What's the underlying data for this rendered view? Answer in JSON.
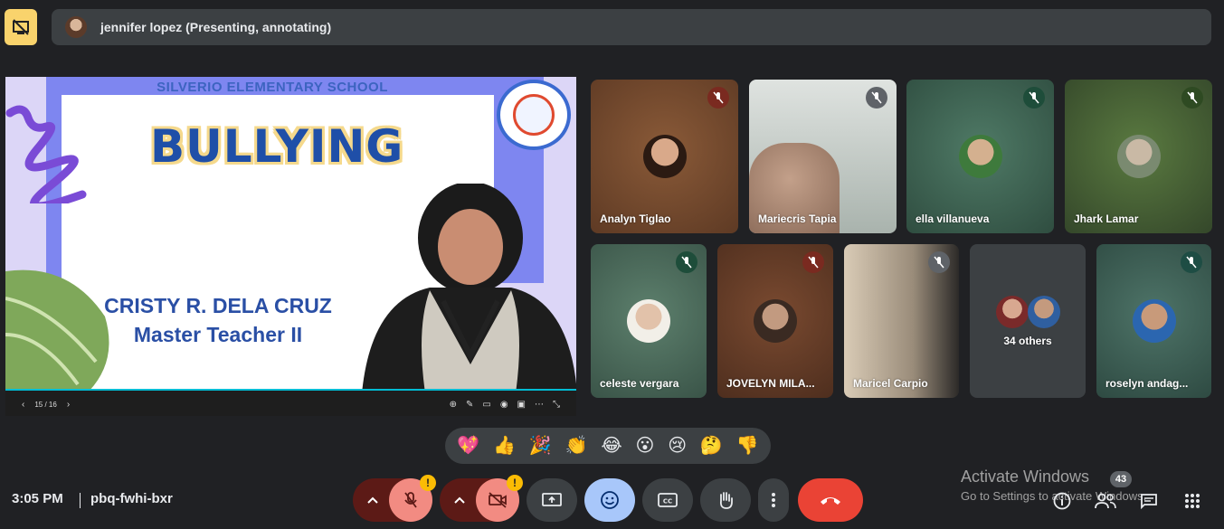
{
  "banner": {
    "presenter_text": "jennifer lopez (Presenting, annotating)"
  },
  "slide": {
    "school": "SILVERIO ELEMENTARY SCHOOL",
    "title": "BULLYING",
    "name": "CRISTY R. DELA CRUZ",
    "role": "Master Teacher II",
    "page_indicator": "15 / 16"
  },
  "participants": [
    {
      "name": "Analyn Tiglao",
      "mic": "muted"
    },
    {
      "name": "Mariecris Tapia",
      "mic": "muted"
    },
    {
      "name": "ella villanueva",
      "mic": "muted"
    },
    {
      "name": "Jhark Lamar",
      "mic": "muted"
    },
    {
      "name": "celeste vergara",
      "mic": "muted"
    },
    {
      "name": "JOVELYN MILA...",
      "mic": "muted"
    },
    {
      "name": "Maricel Carpio",
      "mic": "muted"
    },
    {
      "name": "34 others",
      "mic": ""
    },
    {
      "name": "roselyn andag...",
      "mic": "muted"
    }
  ],
  "reactions": [
    "💖",
    "👍",
    "🎉",
    "👏",
    "😂",
    "😮",
    "😢",
    "🤔",
    "👎"
  ],
  "footer": {
    "time": "3:05 PM",
    "meeting_code": "pbq-fwhi-bxr",
    "watermark_title": "Activate Windows",
    "watermark_sub": "Go to Settings to activate Windows.",
    "people_count": "43"
  },
  "colors": {
    "background": "#202124",
    "banner": "#3c4043",
    "muted_red": "#8c1d18",
    "end_call": "#ea4335",
    "active_blue": "#a8c7fa",
    "warning": "#fbbc04"
  }
}
